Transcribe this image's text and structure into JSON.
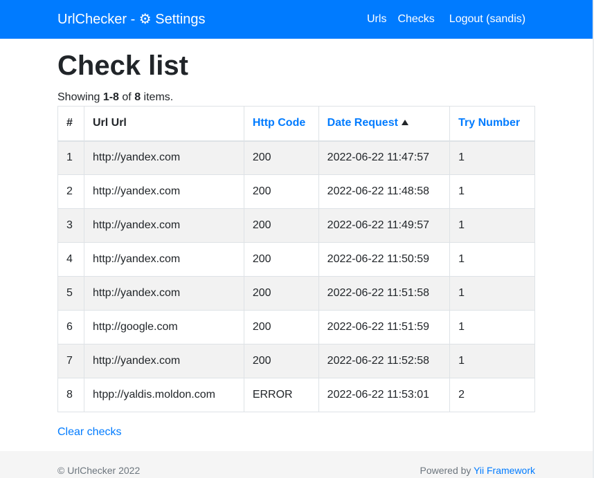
{
  "navbar": {
    "brand": "UrlChecker - ⚙ Settings",
    "links": {
      "urls": "Urls",
      "checks": "Checks",
      "logout": "Logout (sandis)"
    },
    "color": "#007bff"
  },
  "page": {
    "title": "Check list",
    "summary": {
      "prefix": "Showing ",
      "range": "1-8",
      "of": " of ",
      "total": "8",
      "suffix": " items."
    }
  },
  "table": {
    "headers": {
      "num": "#",
      "url": "Url Url",
      "code": "Http Code",
      "date": "Date Request",
      "try": "Try Number"
    },
    "rows": [
      {
        "num": "1",
        "url": "http://yandex.com",
        "code": "200",
        "date": "2022-06-22 11:47:57",
        "try": "1"
      },
      {
        "num": "2",
        "url": "http://yandex.com",
        "code": "200",
        "date": "2022-06-22 11:48:58",
        "try": "1"
      },
      {
        "num": "3",
        "url": "http://yandex.com",
        "code": "200",
        "date": "2022-06-22 11:49:57",
        "try": "1"
      },
      {
        "num": "4",
        "url": "http://yandex.com",
        "code": "200",
        "date": "2022-06-22 11:50:59",
        "try": "1"
      },
      {
        "num": "5",
        "url": "http://yandex.com",
        "code": "200",
        "date": "2022-06-22 11:51:58",
        "try": "1"
      },
      {
        "num": "6",
        "url": "http://google.com",
        "code": "200",
        "date": "2022-06-22 11:51:59",
        "try": "1"
      },
      {
        "num": "7",
        "url": "http://yandex.com",
        "code": "200",
        "date": "2022-06-22 11:52:58",
        "try": "1"
      },
      {
        "num": "8",
        "url": "htpp://yaldis.moldon.com",
        "code": "ERROR",
        "date": "2022-06-22 11:53:01",
        "try": "2"
      }
    ]
  },
  "actions": {
    "clear": "Clear checks"
  },
  "footer": {
    "copyright": "© UrlChecker 2022",
    "powered_prefix": "Powered by ",
    "powered_link": "Yii Framework"
  }
}
